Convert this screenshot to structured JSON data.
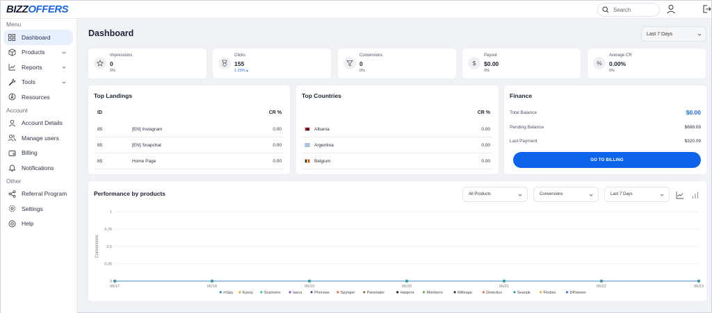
{
  "logo": {
    "part1": "BIZZ",
    "part2": "OFFERS"
  },
  "header": {
    "search_placeholder": "Search"
  },
  "sidebar": {
    "sections": [
      {
        "label": "Menu",
        "items": [
          {
            "label": "Dashboard",
            "icon": "grid-icon",
            "active": true
          },
          {
            "label": "Products",
            "icon": "box-icon",
            "chevron": true
          },
          {
            "label": "Reports",
            "icon": "chart-line-icon",
            "chevron": true
          },
          {
            "label": "Tools",
            "icon": "wrench-icon",
            "chevron": true
          },
          {
            "label": "Resources",
            "icon": "compass-icon"
          }
        ]
      },
      {
        "label": "Account",
        "items": [
          {
            "label": "Account Details",
            "icon": "user-icon"
          },
          {
            "label": "Manage users",
            "icon": "users-icon"
          },
          {
            "label": "Billing",
            "icon": "wallet-icon"
          },
          {
            "label": "Notifications",
            "icon": "bell-icon"
          }
        ]
      },
      {
        "label": "Other",
        "items": [
          {
            "label": "Referral Program",
            "icon": "share-icon"
          },
          {
            "label": "Settings",
            "icon": "gear-icon"
          },
          {
            "label": "Help",
            "icon": "help-icon"
          }
        ]
      }
    ]
  },
  "page": {
    "title": "Dashboard",
    "range": "Last 7 Days"
  },
  "kpis": [
    {
      "label": "Impressions",
      "value": "0",
      "sub": "0%",
      "icon": "star-icon"
    },
    {
      "label": "Clicks",
      "value": "155",
      "sub": "1.29% ▴",
      "icon": "badge-icon",
      "up": true
    },
    {
      "label": "Conversions",
      "value": "0",
      "sub": "0%",
      "icon": "filter-icon"
    },
    {
      "label": "Payout",
      "value": "$0.00",
      "sub": "0%",
      "icon": "dollar-icon"
    },
    {
      "label": "Average CR",
      "value": "0.00%",
      "sub": "0%",
      "icon": "percent-icon"
    }
  ],
  "top_landings": {
    "title": "Top Landings",
    "col_id": "ID",
    "col_cr": "CR %",
    "rows": [
      {
        "id": "85",
        "name": "[EN] Instagram",
        "cr": "0.00"
      },
      {
        "id": "85",
        "name": "[EN] Snapchat",
        "cr": "0.00"
      },
      {
        "id": "85",
        "name": "Home Page",
        "cr": "0.00"
      }
    ]
  },
  "top_countries": {
    "title": "Top Countries",
    "col_cr": "CR %",
    "rows": [
      {
        "name": "Albania",
        "cr": "0.00",
        "flag": [
          "#c8102e",
          "#c8102e"
        ]
      },
      {
        "name": "Argentina",
        "cr": "0.00",
        "flag": [
          "#74acdf",
          "#ffffff"
        ]
      },
      {
        "name": "Belgium",
        "cr": "0.00",
        "flag": [
          "#222222",
          "#fdda24",
          "#ef3340"
        ]
      }
    ]
  },
  "finance": {
    "title": "Finance",
    "total_label": "Total Balance",
    "total_value": "$0.00",
    "pending_label": "Pending Balance",
    "pending_value": "$688.09",
    "last_label": "Last Payment",
    "last_value": "$320.09",
    "button": "GO TO BILLING"
  },
  "performance": {
    "title": "Performance by products",
    "filter_products": "All Products",
    "filter_metric": "Conversions",
    "filter_range": "Last 7 Days"
  },
  "chart_data": {
    "type": "line",
    "ylabel": "Conversions",
    "xlabel": "",
    "x": [
      "06/17",
      "06/18",
      "06/19",
      "06/20",
      "06/21",
      "06/22",
      "06/23"
    ],
    "ylim": [
      0,
      1
    ],
    "yticks": [
      "0",
      "0.25",
      "0.5",
      "0.75",
      "1"
    ],
    "grid": true,
    "legend_position": "bottom",
    "series": [
      {
        "name": "mSpy",
        "color": "#2f7ed8",
        "values": [
          0,
          0,
          0,
          0,
          0,
          0,
          0
        ]
      },
      {
        "name": "Eyezy",
        "color": "#e8a33d",
        "values": [
          0,
          0,
          0,
          0,
          0,
          0,
          0
        ]
      },
      {
        "name": "Scannero",
        "color": "#4bb3a2",
        "values": [
          0,
          0,
          0,
          0,
          0,
          0,
          0
        ]
      },
      {
        "name": "Iasca",
        "color": "#8a4fc8",
        "values": [
          0,
          0,
          0,
          0,
          0,
          0,
          0
        ]
      },
      {
        "name": "Phonsee",
        "color": "#3a5d8f",
        "values": [
          0,
          0,
          0,
          0,
          0,
          0,
          0
        ]
      },
      {
        "name": "Spynger",
        "color": "#e56b3c",
        "values": [
          0,
          0,
          0,
          0,
          0,
          0,
          0
        ]
      },
      {
        "name": "Parentaler",
        "color": "#8c6d3e",
        "values": [
          0,
          0,
          0,
          0,
          0,
          0,
          0
        ]
      },
      {
        "name": "Haqerra",
        "color": "#1b1b3a",
        "values": [
          0,
          0,
          0,
          0,
          0,
          0,
          0
        ]
      },
      {
        "name": "Moniterro",
        "color": "#6aa84f",
        "values": [
          0,
          0,
          0,
          0,
          0,
          0,
          0
        ]
      },
      {
        "name": "Mliteapp",
        "color": "#333333",
        "values": [
          0,
          0,
          0,
          0,
          0,
          0,
          0
        ]
      },
      {
        "name": "Detectico",
        "color": "#e0773a",
        "values": [
          0,
          0,
          0,
          0,
          0,
          0,
          0
        ]
      },
      {
        "name": "Searqle",
        "color": "#2ba39a",
        "values": [
          0,
          0,
          0,
          0,
          0,
          0,
          0
        ]
      },
      {
        "name": "Findsio",
        "color": "#f0a83c",
        "values": [
          0,
          0,
          0,
          0,
          0,
          0,
          0
        ]
      },
      {
        "name": "DPviewer",
        "color": "#2f7ed8",
        "values": [
          0,
          0,
          0,
          0,
          0,
          0,
          0
        ]
      }
    ]
  }
}
